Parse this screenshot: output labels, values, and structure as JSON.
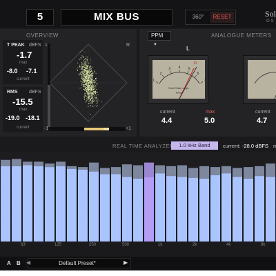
{
  "header": {
    "track_number": "5",
    "bus_name": "MIX BUS",
    "btn_360": "360°",
    "btn_reset": "RESET",
    "brand": "Soli",
    "brand_sub": "OS"
  },
  "overview": {
    "title": "OVERVIEW",
    "true_peak": {
      "label": "T PEAK",
      "unit": "dBFS",
      "max_value": "-1.7",
      "max_label": "max",
      "left_current": "-8.0",
      "right_current": "-7.1",
      "current_label": "current"
    },
    "rms": {
      "label": "RMS",
      "unit": "dBFS",
      "max_value": "-15.5",
      "max_label": "max",
      "left_current": "-19.0",
      "right_current": "-18.1",
      "current_label": "current"
    },
    "gonio_left": "L",
    "gonio_right": "R",
    "corr_min": "-1",
    "corr_max": "+1"
  },
  "analogue": {
    "title": "ANALOGUE METERS",
    "mode": "PPM",
    "left_channel": "L",
    "meter_brand": "Solid State Logic",
    "meter_type": "PPM",
    "left_stats": {
      "current_label": "current",
      "current_value": "4.4",
      "max_label": "max",
      "max_value": "5.0"
    },
    "right_stats": {
      "current_label": "current",
      "current_value": "4.7"
    },
    "scale": [
      "1",
      "2",
      "3",
      "4",
      "5",
      "6",
      "7"
    ]
  },
  "rta": {
    "title": "REAL TIME ANALYZER",
    "band_button": "1.0 kHz Band",
    "current_label": "current:",
    "current_value": "-28.0 dBFS",
    "max_label": "m",
    "freq_labels": [
      "63",
      "125",
      "250",
      "500",
      "1k",
      "2k",
      "4k",
      "8k"
    ],
    "bars_current_pct": [
      84,
      84,
      85,
      84,
      83,
      84,
      81,
      80,
      78,
      75,
      75,
      72,
      70,
      72,
      76,
      73,
      72,
      71,
      70,
      74,
      76,
      72,
      70,
      73,
      72
    ],
    "bars_peak_pct": [
      91,
      92,
      89,
      89,
      87,
      89,
      84,
      83,
      88,
      82,
      83,
      86,
      85,
      88,
      85,
      84,
      85,
      82,
      84,
      83,
      84,
      82,
      83,
      84,
      87
    ],
    "selected_band_index": 13,
    "colors": {
      "bar": "#aac4ff",
      "peak": "#7d879e",
      "selected": "#b39df5",
      "selected_peak": "#9a87d1"
    }
  },
  "footer": {
    "a_label": "A",
    "b_label": "B",
    "prev_arrow": "◀",
    "next_arrow": "▶",
    "preset": "Default Preset*"
  }
}
